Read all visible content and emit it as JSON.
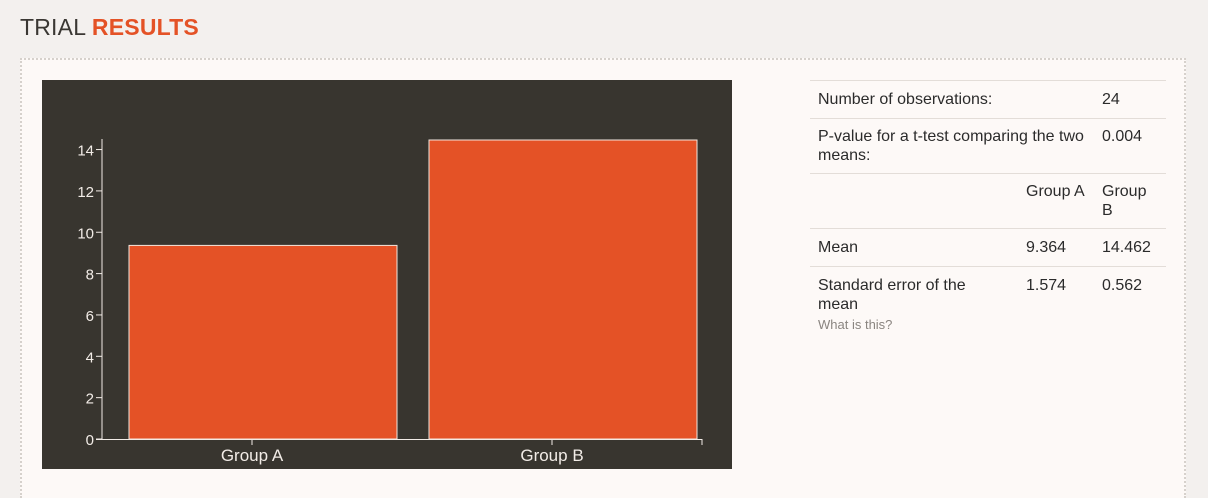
{
  "header": {
    "title_plain": "TRIAL",
    "title_accent": "RESULTS"
  },
  "colors": {
    "accent": "#e45226",
    "chart_background": "#38352f",
    "bar_fill": "#e45226",
    "bar_stroke": "#f2e6df"
  },
  "stats": {
    "observations_label": "Number of observations:",
    "observations_value": "24",
    "pvalue_label": "P-value for a t-test comparing the two means:",
    "pvalue_value": "0.004",
    "group_a_header": "Group A",
    "group_b_header": "Group B",
    "mean_label": "Mean",
    "mean_a": "9.364",
    "mean_b": "14.462",
    "se_label": "Standard error of the mean",
    "se_a": "1.574",
    "se_b": "0.562",
    "help_link": "What is this?"
  },
  "chart_data": {
    "type": "bar",
    "categories": [
      "Group A",
      "Group B"
    ],
    "values": [
      9.364,
      14.462
    ],
    "title": "",
    "xlabel": "",
    "ylabel": "",
    "ylim": [
      0,
      14.462
    ],
    "yticks": [
      0,
      2,
      4,
      6,
      8,
      10,
      12,
      14
    ],
    "grid": false
  }
}
